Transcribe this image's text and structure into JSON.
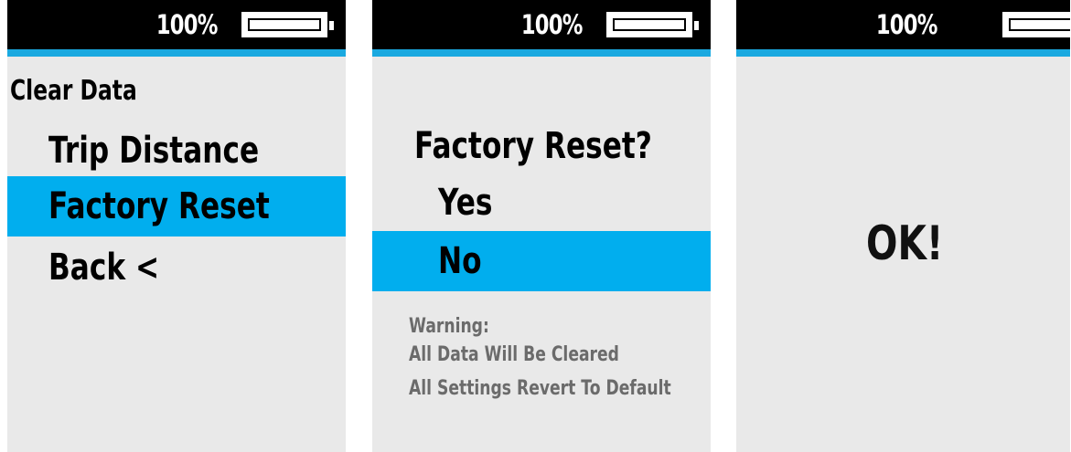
{
  "colors": {
    "accent": "#1aa9e0",
    "highlight": "#01aeee",
    "statusbar": "#000000",
    "screen_bg": "#e9e9e9"
  },
  "icons": {
    "battery": "battery-full-icon"
  },
  "screens": [
    {
      "battery": "100%",
      "title": "Clear Data",
      "items": [
        {
          "label": "Trip Distance",
          "selected": false
        },
        {
          "label": "Factory Reset",
          "selected": true
        },
        {
          "label": "Back <",
          "selected": false
        }
      ]
    },
    {
      "battery": "100%",
      "question": "Factory Reset?",
      "options": [
        {
          "label": "Yes",
          "selected": false
        },
        {
          "label": "No",
          "selected": true
        }
      ],
      "warning": [
        "Warning:",
        "All Data Will Be Cleared",
        "All Settings Revert To Default"
      ]
    },
    {
      "battery": "100%",
      "message": "OK!"
    }
  ]
}
